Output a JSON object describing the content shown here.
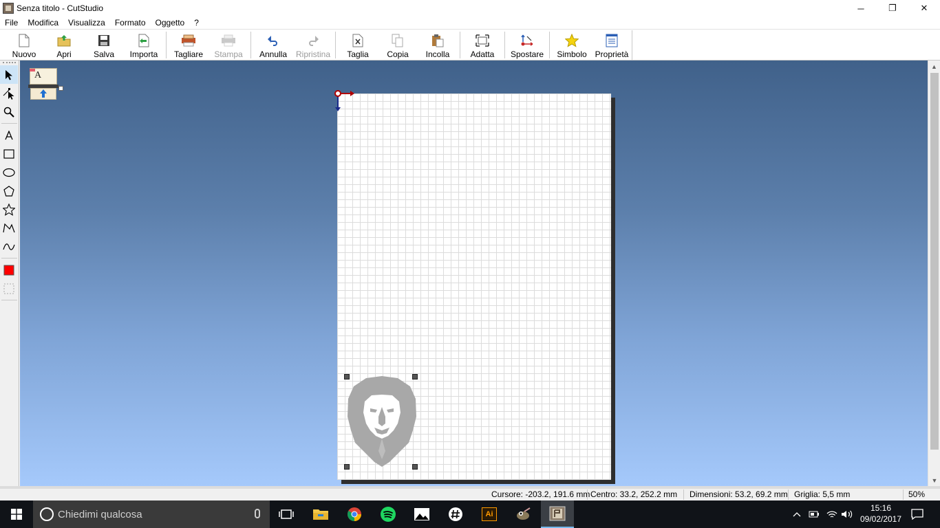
{
  "window": {
    "title": "Senza titolo - CutStudio",
    "minimize": "─",
    "maximize": "❐",
    "close": "✕"
  },
  "menu": [
    "File",
    "Modifica",
    "Visualizza",
    "Formato",
    "Oggetto",
    "?"
  ],
  "toolbar": {
    "nuovo": "Nuovo",
    "apri": "Apri",
    "salva": "Salva",
    "importa": "Importa",
    "tagliare": "Tagliare",
    "stampa": "Stampa",
    "annulla": "Annulla",
    "ripristina": "Ripristina",
    "taglia": "Taglia",
    "copia": "Copia",
    "incolla": "Incolla",
    "adatta": "Adatta",
    "spostare": "Spostare",
    "simbolo": "Simbolo",
    "proprieta": "Proprietà"
  },
  "toolbar_disabled": [
    "Stampa",
    "Ripristina"
  ],
  "canvas": {
    "text_tool_glyph": "A"
  },
  "status": {
    "cursore": "Cursore: -203.2, 191.6 mm",
    "centro": "Centro: 33.2, 252.2 mm",
    "dimensioni": "Dimensioni: 53.2, 69.2 mm",
    "griglia": "Griglia: 5,5 mm",
    "zoom": "50%"
  },
  "taskbar": {
    "search_placeholder": "Chiedimi qualcosa",
    "time": "15:16",
    "date": "09/02/2017",
    "illustrator_label": "Ai"
  },
  "colors": {
    "canvas_top": "#40618a",
    "canvas_bottom": "#a5c9fb",
    "fill_color": "#ff0000",
    "selection_object": "#a8a8a8",
    "taskbar": "#101318"
  }
}
